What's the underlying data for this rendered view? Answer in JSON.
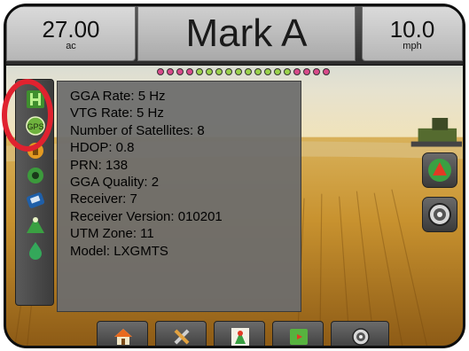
{
  "header": {
    "area": {
      "value": "27.00",
      "unit": "ac"
    },
    "title": "Mark A",
    "speed": {
      "value": "10.0",
      "unit": "mph"
    }
  },
  "lightbar": {
    "leds": [
      "#d84a8a",
      "#d84a8a",
      "#d84a8a",
      "#d84a8a",
      "#9bd34b",
      "#9bd34b",
      "#9bd34b",
      "#9bd34b",
      "#9bd34b",
      "#9bd34b",
      "#9bd34b",
      "#9bd34b",
      "#9bd34b",
      "#9bd34b",
      "#d84a8a",
      "#d84a8a",
      "#d84a8a",
      "#d84a8a"
    ]
  },
  "gps_info": {
    "lines": [
      "GGA Rate: 5 Hz",
      "VTG Rate: 5 Hz",
      "Number of Satellites: 8",
      "HDOP: 0.8",
      "PRN: 138",
      "GGA Quality: 2",
      "Receiver: 7",
      "Receiver Version: 010201",
      "UTM Zone: 11",
      "Model: LXGMTS"
    ]
  },
  "sidebar": {
    "icons": [
      "guidance-mode-icon",
      "gps-status-icon",
      "boom-status-icon",
      "steering-icon",
      "tilt-icon",
      "coverage-icon",
      "rate-icon"
    ]
  },
  "right_buttons": [
    "vehicle-view-icon",
    "camera-icon"
  ],
  "bottom_nav": [
    "home-icon",
    "tools-icon",
    "vehicle-view-icon",
    "map-view-icon",
    "camera-icon"
  ],
  "colors": {
    "highlight_ring": "#e0222f",
    "accent_green": "#4caf3c"
  }
}
